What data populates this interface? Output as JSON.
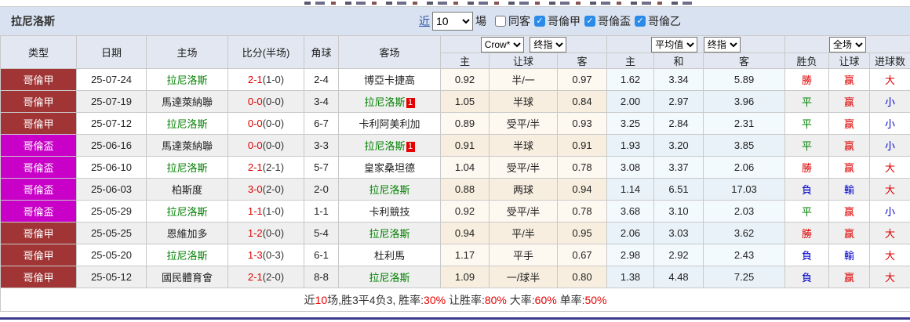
{
  "page": {
    "title_bar": {
      "team_title": "拉尼洛斯",
      "recent_label": "近",
      "recent_value": "10",
      "games_label": "場",
      "same_away": {
        "label": "同客",
        "checked": false
      },
      "league_filters": [
        {
          "label": "哥倫甲",
          "checked": true
        },
        {
          "label": "哥倫盃",
          "checked": true
        },
        {
          "label": "哥倫乙",
          "checked": true
        }
      ]
    }
  },
  "table": {
    "main_headers": [
      "类型",
      "日期",
      "主场",
      "比分(半场)",
      "角球",
      "客场"
    ],
    "group_selects": {
      "asian_source": "Crow*",
      "asian_time": "终指",
      "europe_source": "平均值",
      "europe_time": "终指",
      "scope": "全场"
    },
    "sub_headers": [
      "主",
      "让球",
      "客",
      "主",
      "和",
      "客",
      "胜负",
      "让球",
      "进球数"
    ],
    "focus_team": "拉尼洛斯",
    "rows": [
      {
        "league": "哥倫甲",
        "date": "25-07-24",
        "home": "拉尼洛斯",
        "home_card": "",
        "score": "2-1",
        "half": "(1-0)",
        "corner": "2-4",
        "away": "博亞卡捷高",
        "away_card": "",
        "asian_home": "0.92",
        "handicap": "半/一",
        "asian_away": "0.97",
        "eu_home": "1.62",
        "eu_draw": "3.34",
        "eu_away": "5.89",
        "wdl": "勝",
        "handicap_res": "赢",
        "goals_res": "大"
      },
      {
        "league": "哥倫甲",
        "date": "25-07-19",
        "home": "馬達萊納聯",
        "home_card": "",
        "score": "0-0",
        "half": "(0-0)",
        "corner": "3-4",
        "away": "拉尼洛斯",
        "away_card": "1",
        "asian_home": "1.05",
        "handicap": "半球",
        "asian_away": "0.84",
        "eu_home": "2.00",
        "eu_draw": "2.97",
        "eu_away": "3.96",
        "wdl": "平",
        "handicap_res": "赢",
        "goals_res": "小"
      },
      {
        "league": "哥倫甲",
        "date": "25-07-12",
        "home": "拉尼洛斯",
        "home_card": "",
        "score": "0-0",
        "half": "(0-0)",
        "corner": "6-7",
        "away": "卡利阿美利加",
        "away_card": "",
        "asian_home": "0.89",
        "handicap": "受平/半",
        "asian_away": "0.93",
        "eu_home": "3.25",
        "eu_draw": "2.84",
        "eu_away": "2.31",
        "wdl": "平",
        "handicap_res": "赢",
        "goals_res": "小"
      },
      {
        "league": "哥倫盃",
        "date": "25-06-16",
        "home": "馬達萊納聯",
        "home_card": "",
        "score": "0-0",
        "half": "(0-0)",
        "corner": "3-3",
        "away": "拉尼洛斯",
        "away_card": "1",
        "asian_home": "0.91",
        "handicap": "半球",
        "asian_away": "0.91",
        "eu_home": "1.93",
        "eu_draw": "3.20",
        "eu_away": "3.85",
        "wdl": "平",
        "handicap_res": "赢",
        "goals_res": "小"
      },
      {
        "league": "哥倫盃",
        "date": "25-06-10",
        "home": "拉尼洛斯",
        "home_card": "",
        "score": "2-1",
        "half": "(2-1)",
        "corner": "5-7",
        "away": "皇家桑坦德",
        "away_card": "",
        "asian_home": "1.04",
        "handicap": "受平/半",
        "asian_away": "0.78",
        "eu_home": "3.08",
        "eu_draw": "3.37",
        "eu_away": "2.06",
        "wdl": "勝",
        "handicap_res": "赢",
        "goals_res": "大"
      },
      {
        "league": "哥倫盃",
        "date": "25-06-03",
        "home": "柏斯度",
        "home_card": "",
        "score": "3-0",
        "half": "(2-0)",
        "corner": "2-0",
        "away": "拉尼洛斯",
        "away_card": "",
        "asian_home": "0.88",
        "handicap": "两球",
        "asian_away": "0.94",
        "eu_home": "1.14",
        "eu_draw": "6.51",
        "eu_away": "17.03",
        "wdl": "負",
        "handicap_res": "輸",
        "goals_res": "大"
      },
      {
        "league": "哥倫盃",
        "date": "25-05-29",
        "home": "拉尼洛斯",
        "home_card": "",
        "score": "1-1",
        "half": "(1-0)",
        "corner": "1-1",
        "away": "卡利競技",
        "away_card": "",
        "asian_home": "0.92",
        "handicap": "受平/半",
        "asian_away": "0.78",
        "eu_home": "3.68",
        "eu_draw": "3.10",
        "eu_away": "2.03",
        "wdl": "平",
        "handicap_res": "赢",
        "goals_res": "小"
      },
      {
        "league": "哥倫甲",
        "date": "25-05-25",
        "home": "恩維加多",
        "home_card": "",
        "score": "1-2",
        "half": "(0-0)",
        "corner": "5-4",
        "away": "拉尼洛斯",
        "away_card": "",
        "asian_home": "0.94",
        "handicap": "平/半",
        "asian_away": "0.95",
        "eu_home": "2.06",
        "eu_draw": "3.03",
        "eu_away": "3.62",
        "wdl": "勝",
        "handicap_res": "赢",
        "goals_res": "大"
      },
      {
        "league": "哥倫甲",
        "date": "25-05-20",
        "home": "拉尼洛斯",
        "home_card": "",
        "score": "1-3",
        "half": "(0-3)",
        "corner": "6-1",
        "away": "杜利馬",
        "away_card": "",
        "asian_home": "1.17",
        "handicap": "平手",
        "asian_away": "0.67",
        "eu_home": "2.98",
        "eu_draw": "2.92",
        "eu_away": "2.43",
        "wdl": "負",
        "handicap_res": "輸",
        "goals_res": "大"
      },
      {
        "league": "哥倫甲",
        "date": "25-05-12",
        "home": "國民體育會",
        "home_card": "",
        "score": "2-1",
        "half": "(2-0)",
        "corner": "8-8",
        "away": "拉尼洛斯",
        "away_card": "",
        "asian_home": "1.09",
        "handicap": "一/球半",
        "asian_away": "0.80",
        "eu_home": "1.38",
        "eu_draw": "4.48",
        "eu_away": "7.25",
        "wdl": "負",
        "handicap_res": "赢",
        "goals_res": "大"
      }
    ],
    "footer_segments": [
      {
        "t": "近"
      },
      {
        "t": "10",
        "red": true
      },
      {
        "t": "场,胜3平4负3, 胜率:"
      },
      {
        "t": "30%",
        "red": true
      },
      {
        "t": " 让胜率:"
      },
      {
        "t": "80%",
        "red": true
      },
      {
        "t": " 大率:"
      },
      {
        "t": "60%",
        "red": true
      },
      {
        "t": " 单率:"
      },
      {
        "t": "50%",
        "red": true
      }
    ]
  },
  "colors": {
    "league": {
      "哥倫甲": "#A13535",
      "哥倫盃": "#C800C8"
    },
    "result": {
      "勝": "#DD0000",
      "平": "#008000",
      "負": "#0000CC",
      "赢": "#DD0000",
      "輸": "#0000CC",
      "大": "#DD0000",
      "小": "#0000CC"
    },
    "focus_team_color": "#008000",
    "accent_line": "#3C3C8E"
  }
}
